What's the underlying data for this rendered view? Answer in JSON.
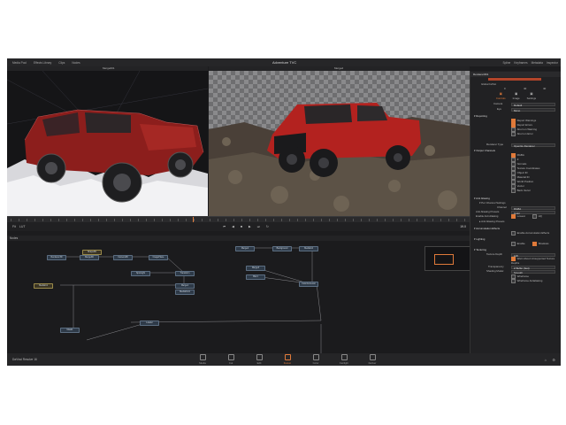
{
  "window_title": "Adventure TVC",
  "topbar": {
    "workspaces": [
      "Media Pool",
      "Effects Library",
      "Clips",
      "Nodes"
    ],
    "right_items": [
      "Spline",
      "Keyframes",
      "Metadata",
      "Inspector"
    ]
  },
  "viewers": {
    "left_label": "Merge001",
    "right_label": "Merge2"
  },
  "transport": {
    "left_zoom": "Fit",
    "left_view": "LUT",
    "frame": "19.0"
  },
  "nodes_panel": {
    "title": "Nodes",
    "nodes": [
      {
        "label": "Renderer3D",
        "kind": "b"
      },
      {
        "label": "Merge3D",
        "kind": "b"
      },
      {
        "label": "Camera3D",
        "kind": "b"
      },
      {
        "label": "ImagePlane",
        "kind": "b"
      },
      {
        "label": "Shape3D",
        "kind": "y"
      },
      {
        "label": "MediaIn1",
        "kind": "y"
      },
      {
        "label": "Merge1",
        "kind": "b"
      },
      {
        "label": "SpotLight",
        "kind": "b"
      },
      {
        "label": "Transform",
        "kind": "b"
      },
      {
        "label": "MediaOut1",
        "kind": "b"
      },
      {
        "label": "Merge2",
        "kind": "b"
      },
      {
        "label": "Background",
        "kind": "b"
      },
      {
        "label": "MediaIn2",
        "kind": "b"
      },
      {
        "label": "Merge3",
        "kind": "b"
      },
      {
        "label": "Blur1",
        "kind": "b"
      },
      {
        "label": "ColorCorrector",
        "kind": "b"
      },
      {
        "label": "Mask1",
        "kind": "b"
      },
      {
        "label": "Loader",
        "kind": "b"
      }
    ]
  },
  "pages": [
    "Media",
    "Cut",
    "Edit",
    "Fusion",
    "Color",
    "Fairlight",
    "Deliver"
  ],
  "active_page": "Fusion",
  "app_name": "DaVinci Resolve 16",
  "inspector": {
    "title": "Inspector",
    "tool": "Renderer3D1",
    "global_in_out_label": "Global In/Out",
    "global_in_out_values": [
      "0",
      "40",
      "40"
    ],
    "tabs": [
      "Controls",
      "Image",
      "Settings"
    ],
    "camera_label": "Camera",
    "camera_value": "Default",
    "eye_label": "Eye",
    "eye_value": "Mono",
    "reporting_title": "Reporting",
    "reporting": [
      {
        "label": "Report Warnings",
        "on": true
      },
      {
        "label": "Report Errors",
        "on": true
      },
      {
        "label": "Abort on Warning",
        "on": false
      },
      {
        "label": "Abort on Error",
        "on": false
      }
    ],
    "renderer_type_label": "Renderer Type",
    "renderer_type_value": "OpenGL Renderer",
    "output_channels_title": "Output Channels",
    "output_channels": [
      {
        "label": "RGBA",
        "on": true
      },
      {
        "label": "Z",
        "on": false
      },
      {
        "label": "Normals",
        "on": false
      },
      {
        "label": "Texture Coordinates",
        "on": false
      },
      {
        "label": "Object ID",
        "on": false
      },
      {
        "label": "Material ID",
        "on": false
      },
      {
        "label": "World Position",
        "on": false
      },
      {
        "label": "Vector",
        "on": false
      },
      {
        "label": "Back Vector",
        "on": false
      }
    ],
    "anti_aliasing_title": "Anti Aliasing",
    "per_channel_label": "Per Channel Settings",
    "channel_label": "Channel",
    "channel_value": "RGBA",
    "aa_preset_label": "Anti Aliasing Presets",
    "aa_preset_value": "Color",
    "enable_aa_label": "Enable Anti Aliasing",
    "enable_aa_options": [
      "Lowest",
      "HQ"
    ],
    "aa_presets_title": "Anti Aliasing Presets",
    "accum_title": "Accumulation Effects",
    "accum_value": "Enable Accumulation Effects",
    "lighting_title": "Lighting",
    "lighting_options": [
      "Enable",
      "Shadows"
    ],
    "texturing_title": "Texturing",
    "texture_depth_label": "Texture Depth",
    "texture_depth_value": "int8",
    "texturing_options": [
      "Warn About Unsupported Texture Depths"
    ],
    "transparency_label": "Transparency",
    "transparency_value": "Z Buffer (fast)",
    "shading_label": "Shading Model",
    "shading_value": "Smooth",
    "wireframe_options": [
      "Wireframe",
      "Wireframe Antialiasing"
    ]
  },
  "colors": {
    "accent": "#e07a3a",
    "jeep_red": "#b3221f",
    "bg": "#1c1c1e"
  }
}
